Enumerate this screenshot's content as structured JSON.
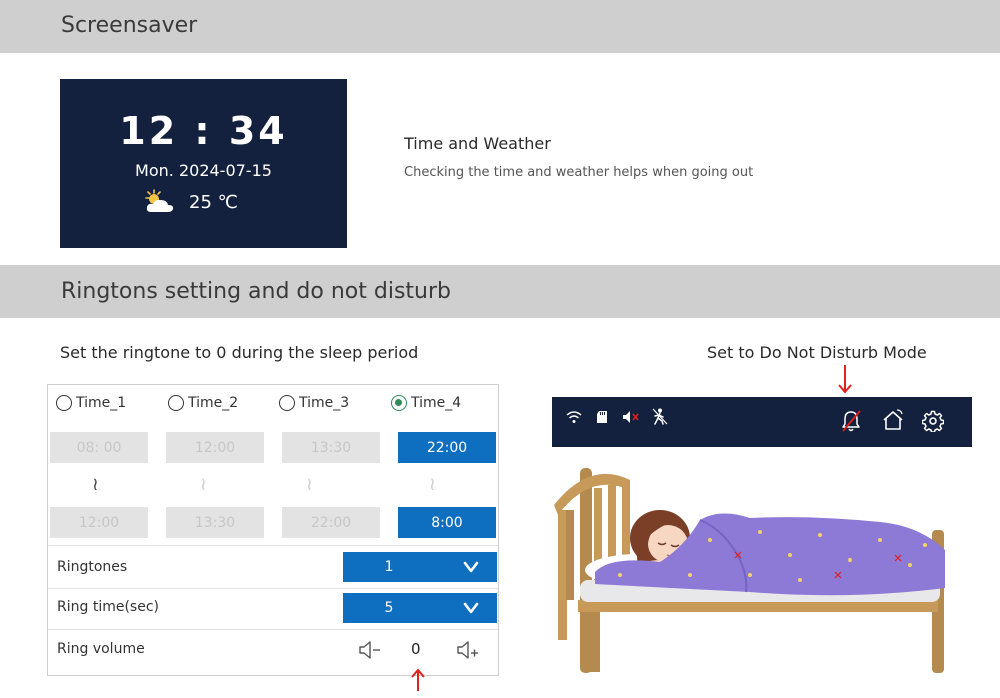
{
  "sections": {
    "screensaver": "Screensaver",
    "ringtones": "Ringtons setting and do not disturb"
  },
  "clock": {
    "time": "12 : 34",
    "date": "Mon.  2024-07-15",
    "temperature": "25 ℃",
    "weather_icon": "partly-cloudy-icon"
  },
  "time_weather": {
    "title": "Time and Weather",
    "description": "Checking the time and weather helps when going out"
  },
  "captions": {
    "left": "Set the ringtone to 0 during the sleep period",
    "right": "Set to Do Not Disturb Mode"
  },
  "settings": {
    "time_slots": [
      {
        "label": "Time_1",
        "start": "08: 00",
        "end": "12:00",
        "selected": false
      },
      {
        "label": "Time_2",
        "start": "12:00",
        "end": "13:30",
        "selected": false
      },
      {
        "label": "Time_3",
        "start": "13:30",
        "end": "22:00",
        "selected": false
      },
      {
        "label": "Time_4",
        "start": "22:00",
        "end": "8:00",
        "selected": true
      }
    ],
    "range_symbol": "≀",
    "ringtones": {
      "label": "Ringtones",
      "value": "1"
    },
    "ring_time": {
      "label": "Ring time(sec)",
      "value": "5"
    },
    "ring_volume": {
      "label": "Ring volume",
      "value": "0"
    }
  },
  "status_bar": {
    "left_icons": [
      "wifi-icon",
      "sd-card-icon",
      "mute-icon",
      "motion-sensor-icon"
    ],
    "right_icons": [
      "bell-off-icon",
      "home-icon",
      "gear-icon"
    ]
  },
  "colors": {
    "accent": "#0e6fc1",
    "panel_dark": "#13213f",
    "radio_selected": "#2e8b57",
    "arrow": "#e0201c",
    "band": "#cfcfcf"
  }
}
